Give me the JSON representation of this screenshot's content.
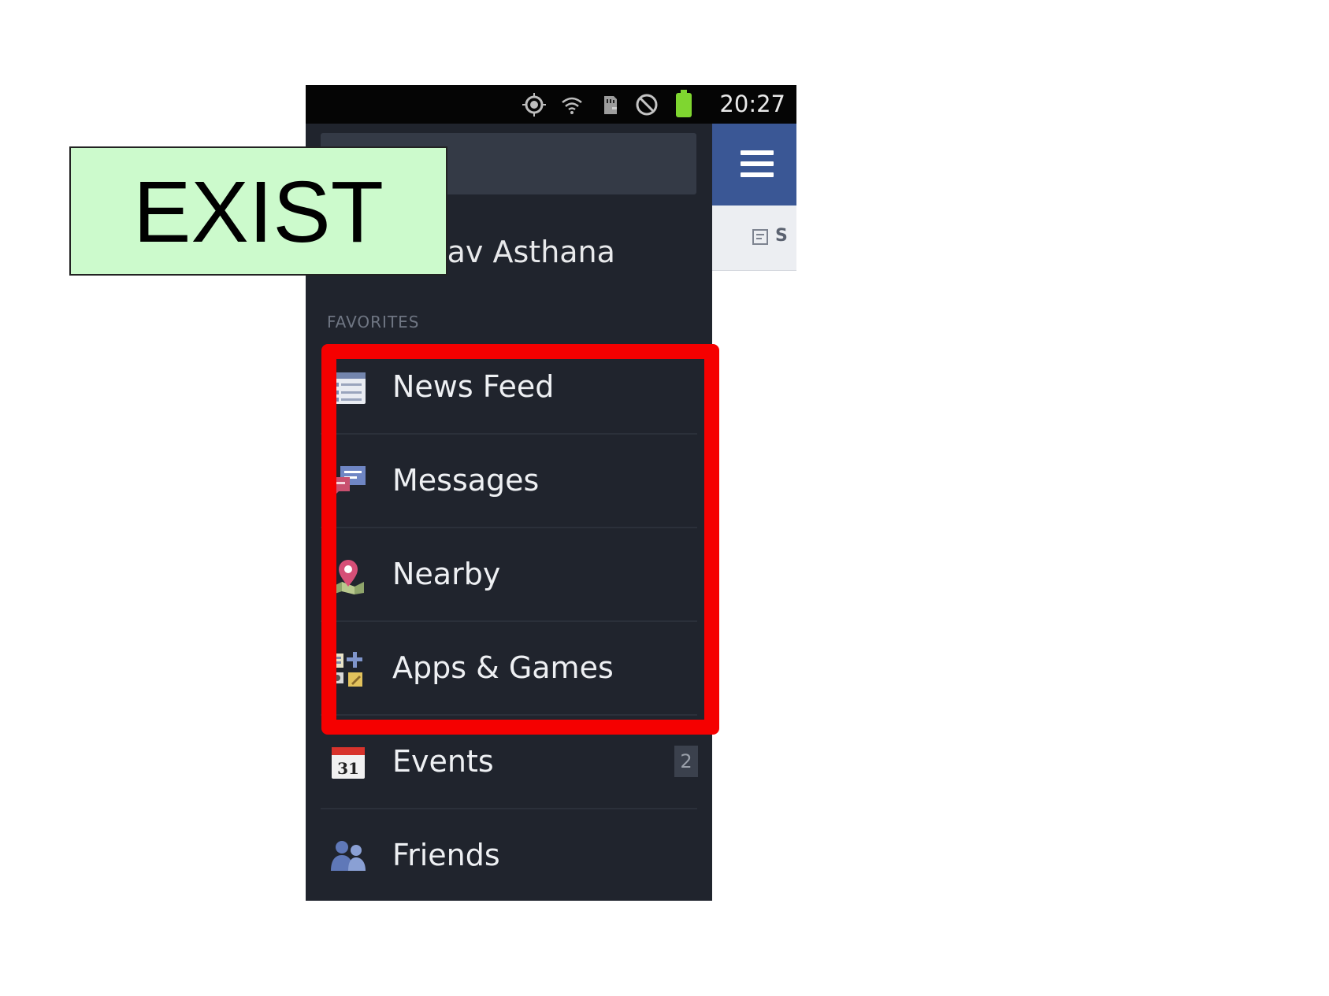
{
  "annotation": {
    "label": "EXIST",
    "label_bg": "#ccfacc",
    "highlight_color": "#f50000"
  },
  "statusbar": {
    "time": "20:27",
    "icons": [
      "gps-icon",
      "wifi-icon",
      "sd-card-icon",
      "no-sound-icon",
      "battery-icon"
    ]
  },
  "drawer": {
    "search_placeholder": "",
    "profile_name": "inav Asthana",
    "favorites_header": "FAVORITES",
    "items": [
      {
        "label": "News Feed",
        "icon": "news-feed-icon"
      },
      {
        "label": "Messages",
        "icon": "messages-icon"
      },
      {
        "label": "Nearby",
        "icon": "nearby-pin-icon"
      },
      {
        "label": "Apps & Games",
        "icon": "apps-games-icon"
      },
      {
        "label": "Events",
        "icon": "calendar-icon",
        "badge": "2",
        "calendar_day": "31"
      },
      {
        "label": "Friends",
        "icon": "friends-icon"
      }
    ]
  },
  "content": {
    "topbar_color": "#3a5795",
    "status_partial": "S"
  }
}
